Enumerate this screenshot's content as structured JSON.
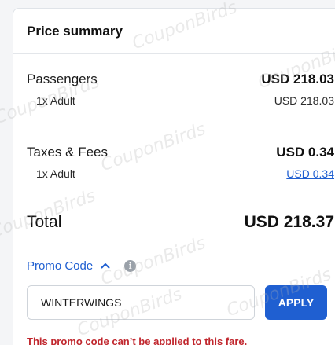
{
  "summary": {
    "title": "Price summary",
    "passengers": {
      "label": "Passengers",
      "amount": "USD 218.03",
      "sub_label": "1x Adult",
      "sub_amount": "USD 218.03"
    },
    "taxes": {
      "label": "Taxes & Fees",
      "amount": "USD 0.34",
      "sub_label": "1x Adult",
      "sub_amount": "USD 0.34"
    },
    "total": {
      "label": "Total",
      "amount": "USD 218.37"
    }
  },
  "promo": {
    "toggle_label": "Promo Code",
    "info_glyph": "i",
    "input_value": "WINTERWINGS",
    "apply_label": "APPLY",
    "error": "This promo code can’t be applied to this fare."
  },
  "watermark": "CouponBirds",
  "colors": {
    "accent": "#1f5fd1",
    "error": "#c0262d"
  }
}
